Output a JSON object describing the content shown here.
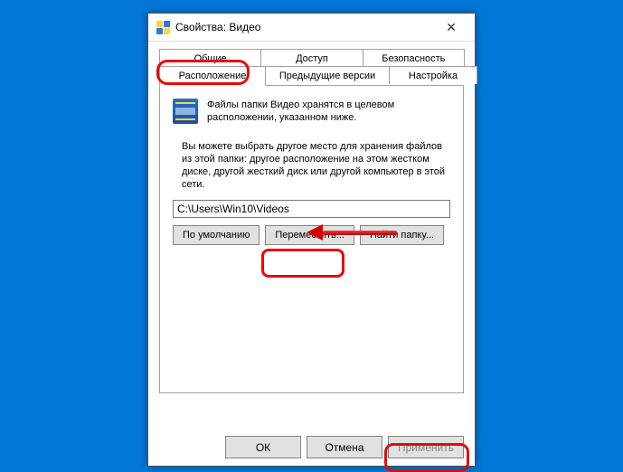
{
  "window": {
    "title": "Свойства: Видео"
  },
  "tabs": {
    "row1": [
      "Общие",
      "Доступ",
      "Безопасность"
    ],
    "row2": [
      "Расположение",
      "Предыдущие версии",
      "Настройка"
    ],
    "active": "Расположение"
  },
  "body": {
    "line1": "Файлы папки Видео хранятся в целевом расположении, указанном ниже.",
    "line2": "Вы можете выбрать другое место для хранения файлов из этой папки: другое расположение на этом жестком диске, другой жесткий диск или другой компьютер в этой сети.",
    "path": "C:\\Users\\Win10\\Videos",
    "buttons": {
      "default": "По умолчанию",
      "move": "Переместить...",
      "find": "Найти папку..."
    }
  },
  "footer": {
    "ok": "ОК",
    "cancel": "Отмена",
    "apply": "Применить"
  }
}
